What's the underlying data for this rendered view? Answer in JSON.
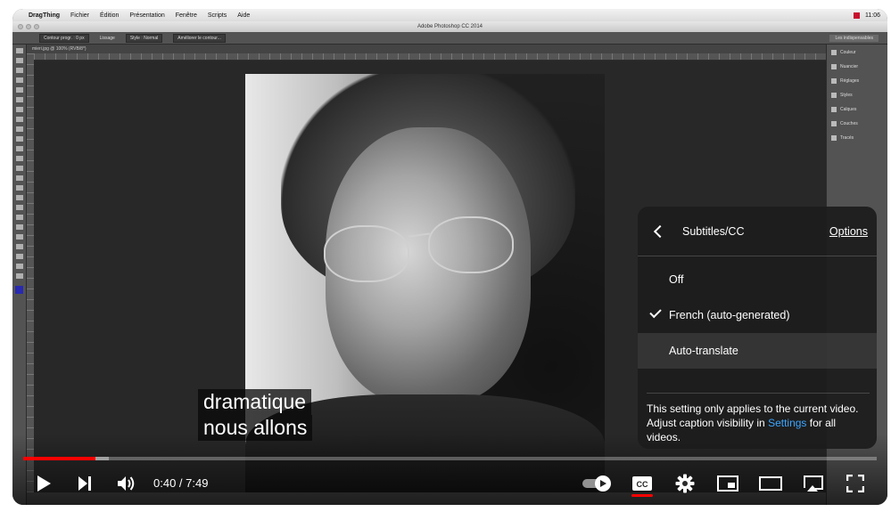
{
  "screen": {
    "menubar": {
      "app": "DragThing",
      "items": [
        "Fichier",
        "Édition",
        "Présentation",
        "Fenêtre",
        "Scripts",
        "Aide"
      ],
      "clock": "11:06"
    },
    "window_title": "Adobe Photoshop CC 2014",
    "document_tab": "mieri.jpg @ 100% (RVB/8*)",
    "workspace": "Les indispensables",
    "options_bar": [
      "Contour progr. : 0 px",
      "Lissage",
      "Style : Normal",
      "Améliorer le contour..."
    ],
    "panels": [
      "Couleur",
      "Nuancier",
      "Réglages",
      "Styles",
      "Calques",
      "Couches",
      "Tracés"
    ]
  },
  "captions": {
    "line1": "dramatique",
    "line2": "nous allons"
  },
  "subtitles_menu": {
    "title": "Subtitles/CC",
    "options_link": "Options",
    "items": [
      {
        "label": "Off",
        "selected": false
      },
      {
        "label": "French (auto-generated)",
        "selected": true
      },
      {
        "label": "Auto-translate",
        "selected": false
      }
    ],
    "note_text": "This setting only applies to the current video. Adjust caption visibility in ",
    "note_link": "Settings",
    "note_tail": " for all videos."
  },
  "player": {
    "current_time": "0:40",
    "duration": "7:49",
    "time_display": "0:40 / 7:49",
    "progress_played": 0.085,
    "progress_buffered": 0.1,
    "autoplay_on": true,
    "captions_on": true
  },
  "colors": {
    "accent_red": "#ff0000",
    "link_blue": "#3ea6ff",
    "menu_bg": "#1c1c1c"
  },
  "icons": [
    "back-icon",
    "check-icon",
    "play-icon",
    "next-icon",
    "volume-icon",
    "autoplay-toggle-icon",
    "cc-icon",
    "settings-gear-icon",
    "miniplayer-icon",
    "theater-mode-icon",
    "cast-icon",
    "fullscreen-icon"
  ]
}
